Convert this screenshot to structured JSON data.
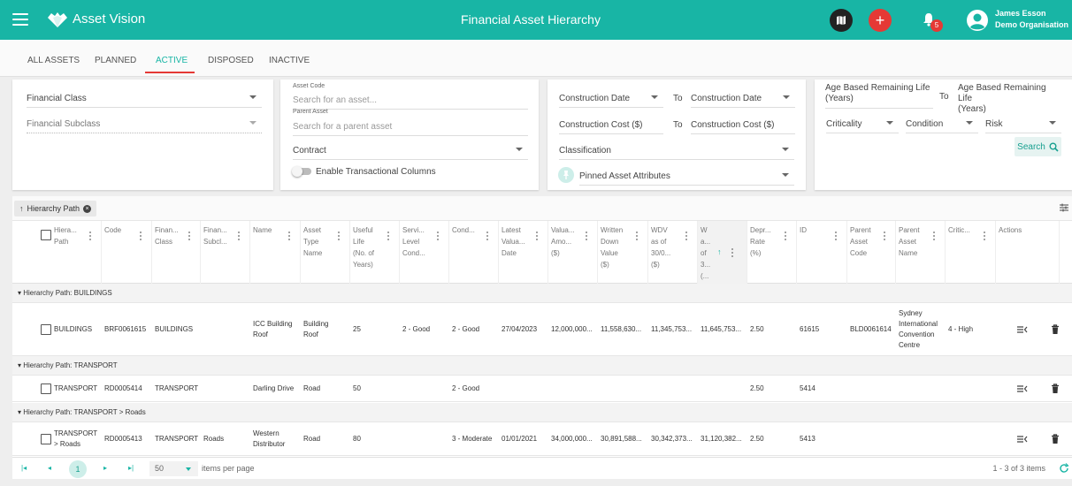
{
  "app": {
    "brand": "Asset Vision",
    "page_title": "Financial Asset Hierarchy",
    "notification_count": "5",
    "user_name": "James Esson",
    "user_org": "Demo Organisation",
    "accent_color": "#18b5a5"
  },
  "tabs": [
    {
      "label": "ALL ASSETS"
    },
    {
      "label": "PLANNED"
    },
    {
      "label": "ACTIVE",
      "active": true
    },
    {
      "label": "DISPOSED"
    },
    {
      "label": "INACTIVE"
    }
  ],
  "filters": {
    "financial_class": "Financial Class",
    "financial_subclass": "Financial Subclass",
    "asset_code_label": "Asset Code",
    "asset_code_placeholder": "Search for an asset...",
    "parent_asset_label": "Parent Asset",
    "parent_asset_placeholder": "Search for a parent asset",
    "contract": "Contract",
    "toggle_label": "Enable Transactional Columns",
    "construction_date_from": "Construction Date",
    "construction_date_to": "Construction Date",
    "construction_cost_from": "Construction Cost ($)",
    "construction_cost_to": "Construction Cost ($)",
    "to": "To",
    "classification": "Classification",
    "pinned_attributes": "Pinned Asset Attributes",
    "age_life_from_1": "Age Based Remaining Life",
    "age_life_from_2": "(Years)",
    "age_life_to_1": "Age Based Remaining Life",
    "age_life_to_2": "(Years)",
    "criticality": "Criticality",
    "condition": "Condition",
    "risk": "Risk",
    "search_button": "Search"
  },
  "grid": {
    "group_chip": "Hierarchy Path",
    "columns": [
      {
        "l1": "Hiera...",
        "l2": "Path"
      },
      {
        "l1": "Code"
      },
      {
        "l1": "Finan...",
        "l2": "Class"
      },
      {
        "l1": "Finan...",
        "l2": "Subcl..."
      },
      {
        "l1": "Name"
      },
      {
        "l1": "Asset",
        "l2": "Type",
        "l3": "Name"
      },
      {
        "l1": "Useful",
        "l2": "Life",
        "l3": "(No. of",
        "l4": "Years)"
      },
      {
        "l1": "Servi...",
        "l2": "Level",
        "l3": "Cond..."
      },
      {
        "l1": "Cond..."
      },
      {
        "l1": "Latest",
        "l2": "Valua...",
        "l3": "Date"
      },
      {
        "l1": "Valua...",
        "l2": "Amo...",
        "l3": "($)"
      },
      {
        "l1": "Written",
        "l2": "Down",
        "l3": "Value",
        "l4": "($)"
      },
      {
        "l1": "WDV",
        "l2": "as of",
        "l3": "30/0...",
        "l4": "($)"
      },
      {
        "l1": "W",
        "l2": "a...",
        "l3": "of",
        "l4": "3...",
        "l5": "(..."
      },
      {
        "l1": "Depr...",
        "l2": "Rate",
        "l3": "(%)"
      },
      {
        "l1": "ID"
      },
      {
        "l1": "Parent",
        "l2": "Asset",
        "l3": "Code"
      },
      {
        "l1": "Parent",
        "l2": "Asset",
        "l3": "Name"
      },
      {
        "l1": "Critic..."
      },
      {
        "l1": "Actions"
      }
    ],
    "groups": [
      {
        "label": "Hierarchy Path: BUILDINGS",
        "row": {
          "path": [
            "BUILDINGS"
          ],
          "code": "BRF0061615",
          "fin_class": "BUILDINGS",
          "fin_subclass": "",
          "name": [
            "ICC Building",
            "Roof"
          ],
          "asset_type": [
            "Building",
            "Roof"
          ],
          "useful_life": "25",
          "service_level": "2 - Good",
          "condition": "2 - Good",
          "valuation_date": "27/04/2023",
          "valuation_amount": "12,000,000...",
          "written_down": "11,558,630...",
          "wdv_as_of": "11,345,753...",
          "wdv_sorted": "11,645,753...",
          "depr_rate": "2.50",
          "id": "61615",
          "parent_code": "BLD0061614",
          "parent_name": [
            "Sydney",
            "International",
            "Convention",
            "Centre"
          ],
          "criticality": "4 - High"
        }
      },
      {
        "label": "Hierarchy Path: TRANSPORT",
        "row": {
          "path": [
            "TRANSPORT"
          ],
          "code": "RD0005414",
          "fin_class": "TRANSPORT",
          "fin_subclass": "",
          "name": [
            "Darling Drive"
          ],
          "asset_type": [
            "Road"
          ],
          "useful_life": "50",
          "service_level": "",
          "condition": "2 - Good",
          "valuation_date": "",
          "valuation_amount": "",
          "written_down": "",
          "wdv_as_of": "",
          "wdv_sorted": "",
          "depr_rate": "2.50",
          "id": "5414",
          "parent_code": "",
          "parent_name": [],
          "criticality": ""
        }
      },
      {
        "label": "Hierarchy Path: TRANSPORT > Roads",
        "row": {
          "path": [
            "TRANSPORT",
            "> Roads"
          ],
          "code": "RD0005413",
          "fin_class": "TRANSPORT",
          "fin_subclass": "Roads",
          "name": [
            "Western",
            "Distributor"
          ],
          "asset_type": [
            "Road"
          ],
          "useful_life": "80",
          "service_level": "",
          "condition": "3 - Moderate",
          "valuation_date": "01/01/2021",
          "valuation_amount": "34,000,000...",
          "written_down": "30,891,588...",
          "wdv_as_of": "30,342,373...",
          "wdv_sorted": "31,120,382...",
          "depr_rate": "2.50",
          "id": "5413",
          "parent_code": "",
          "parent_name": [],
          "criticality": ""
        }
      }
    ]
  },
  "paginator": {
    "current_page": "1",
    "page_size": "50",
    "items_per_page_label": "items per page",
    "range_label": "1 - 3 of 3 items"
  }
}
